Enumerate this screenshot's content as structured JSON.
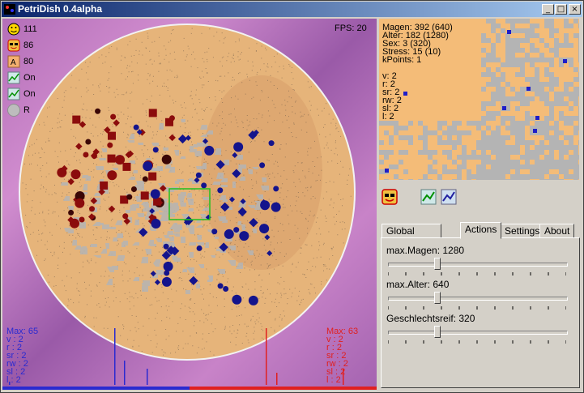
{
  "window": {
    "title": "PetriDish 0.4alpha",
    "min": "_",
    "max": "□",
    "close": "×"
  },
  "stats": [
    {
      "icon": "smiley-icon",
      "value": "111"
    },
    {
      "icon": "sunglasses-smiley-icon",
      "value": "86"
    },
    {
      "icon": "a-icon",
      "value": "80"
    },
    {
      "icon": "graph-toggle-icon",
      "value": "On"
    },
    {
      "icon": "graph-toggle-2-icon",
      "value": "On"
    },
    {
      "icon": "gray-circle-icon",
      "value": "R"
    }
  ],
  "fps": "FPS: 20",
  "hist_left": [
    "Max: 65",
    "v : 2",
    "r : 2",
    "sr : 2",
    "rw : 2",
    "sl : 2",
    "l : 2"
  ],
  "hist_right": [
    "Max: 63",
    "v : 2",
    "r : 2",
    "sr : 2",
    "rw : 2",
    "sl : 2",
    "l : 2"
  ],
  "info": {
    "lines": [
      "Magen: 392 (640)",
      "Alter: 182 (1280)",
      "Sex: 3 (320)",
      "Stress: 15 (10)",
      "kPoints: 1"
    ],
    "lines2": [
      "v: 2",
      "r: 2",
      "sr: 2",
      "rw: 2",
      "sl: 2",
      "l: 2"
    ]
  },
  "tabs": [
    "Global Parameters",
    "Actions",
    "Settings",
    "About"
  ],
  "active_tab": "Actions",
  "sliders": [
    {
      "label": "max.Magen: 1280",
      "level": 0.27
    },
    {
      "label": "max.Alter: 640",
      "level": 0.27
    },
    {
      "label": "Geschlechtsreif: 320",
      "level": 0.27
    }
  ],
  "colors": {
    "dish": "#e6b47a",
    "red_cell": "#8b0c0c",
    "blue_cell": "#14148c",
    "trail": "#b4b4b4"
  }
}
